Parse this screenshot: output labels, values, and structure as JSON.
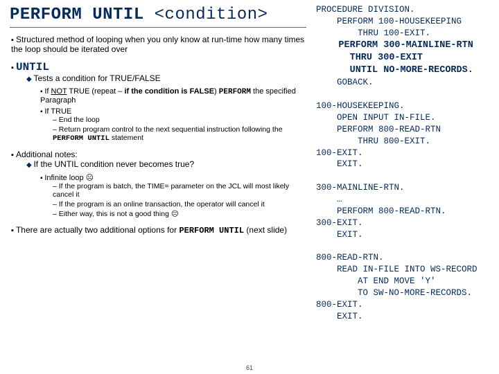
{
  "title_kw": "PERFORM UNTIL",
  "title_param": "<condition>",
  "left": {
    "intro": "Structured method of looping when you only know at run-time how many times the loop should be iterated over",
    "until_kw": "UNTIL",
    "until_sub": "Tests a condition for TRUE/FALSE",
    "until_not_pre": "If ",
    "until_not_word": "NOT",
    "until_not_mid": " TRUE (repeat – ",
    "until_not_bold": "if the condition is FALSE",
    "until_not_paren": ") ",
    "until_not_perf": "PERFORM",
    "until_not_tail": " the specified Paragraph",
    "until_true": "If TRUE",
    "true_a": "End the loop",
    "true_b_pre": "Return program control to the next sequential instruction following the ",
    "true_b_kw": "PERFORM UNTIL",
    "true_b_post": " statement",
    "addl_head": "Additional notes:",
    "addl_q": "If the UNTIL condition never becomes true?",
    "inf_loop": "Infinite loop ☹",
    "inf_a": "If the program is batch, the TIME= parameter on the JCL will most likely cancel it",
    "inf_b": "If the program is an online transaction, the operator will cancel it",
    "inf_c": "Either way, this is not a good thing ☹",
    "two_opts_pre": "There are actually two additional options for ",
    "two_opts_kw": "PERFORM UNTIL",
    "two_opts_post": " (next slide)"
  },
  "code": {
    "l01": "PROCEDURE DIVISION.",
    "l02": "    PERFORM 100-HOUSEKEEPING",
    "l03": "        THRU 100-EXIT.",
    "l04": "    PERFORM 300-MAINLINE-RTN",
    "l05": "      THRU 300-EXIT",
    "l06": "      UNTIL NO-MORE-RECORDS.",
    "l07": "    GOBACK.",
    "l08": "",
    "l09": "100-HOUSEKEEPING.",
    "l10": "    OPEN INPUT IN-FILE.",
    "l11": "    PERFORM 800-READ-RTN",
    "l12": "        THRU 800-EXIT.",
    "l13": "100-EXIT.",
    "l14": "    EXIT.",
    "l15": "",
    "l16": "300-MAINLINE-RTN.",
    "l17": "    …",
    "l18": "    PERFORM 800-READ-RTN.",
    "l19": "300-EXIT.",
    "l20": "    EXIT.",
    "l21": "",
    "l22": "800-READ-RTN.",
    "l23": "    READ IN-FILE INTO WS-RECORD",
    "l24": "        AT END MOVE 'Y'",
    "l25": "        TO SW-NO-MORE-RECORDS.",
    "l26": "800-EXIT.",
    "l27": "    EXIT."
  },
  "page": "61"
}
